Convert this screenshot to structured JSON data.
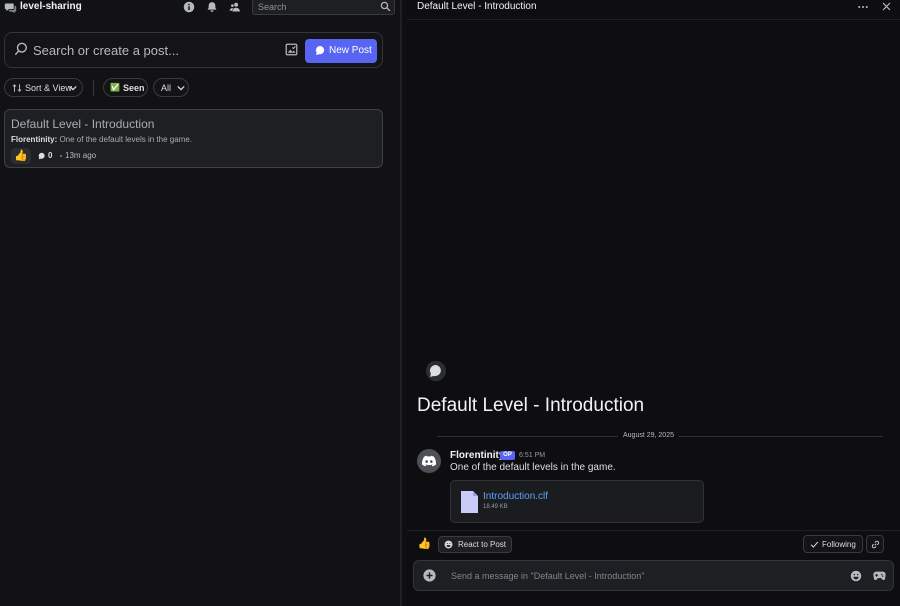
{
  "channel": {
    "name": "level-sharing"
  },
  "top_search": {
    "placeholder": "Search"
  },
  "forum": {
    "search_placeholder": "Search or create a post...",
    "new_post_label": "New Post",
    "sort_label": "Sort & View",
    "seen_label": "Seen",
    "seen_emoji": "✅",
    "filter_label": "All"
  },
  "posts": [
    {
      "title": "Default Level - Introduction",
      "author": "Florentinity",
      "separator": ":",
      "preview": " One of the default levels in the game.",
      "reaction_emoji": "👍",
      "message_count": "0",
      "age": "13m ago"
    }
  ],
  "thread": {
    "header_title": "Default Level - Introduction",
    "title": "Default Level - Introduction",
    "date": "August 29, 2025",
    "message": {
      "author": "Florentinity",
      "badge": "OP",
      "time": "6:51 PM",
      "text": "One of the default levels in the game.",
      "attachment": {
        "name": "Introduction.clf",
        "size": "18.49 KB"
      }
    },
    "reaction_emoji": "👍",
    "react_label": "React to Post",
    "following_label": "Following",
    "composer_placeholder": "Send a message in \"Default Level - Introduction\""
  },
  "colors": {
    "accent": "#5865f2",
    "link": "#5aa4f5",
    "background": "#0e0e10"
  }
}
